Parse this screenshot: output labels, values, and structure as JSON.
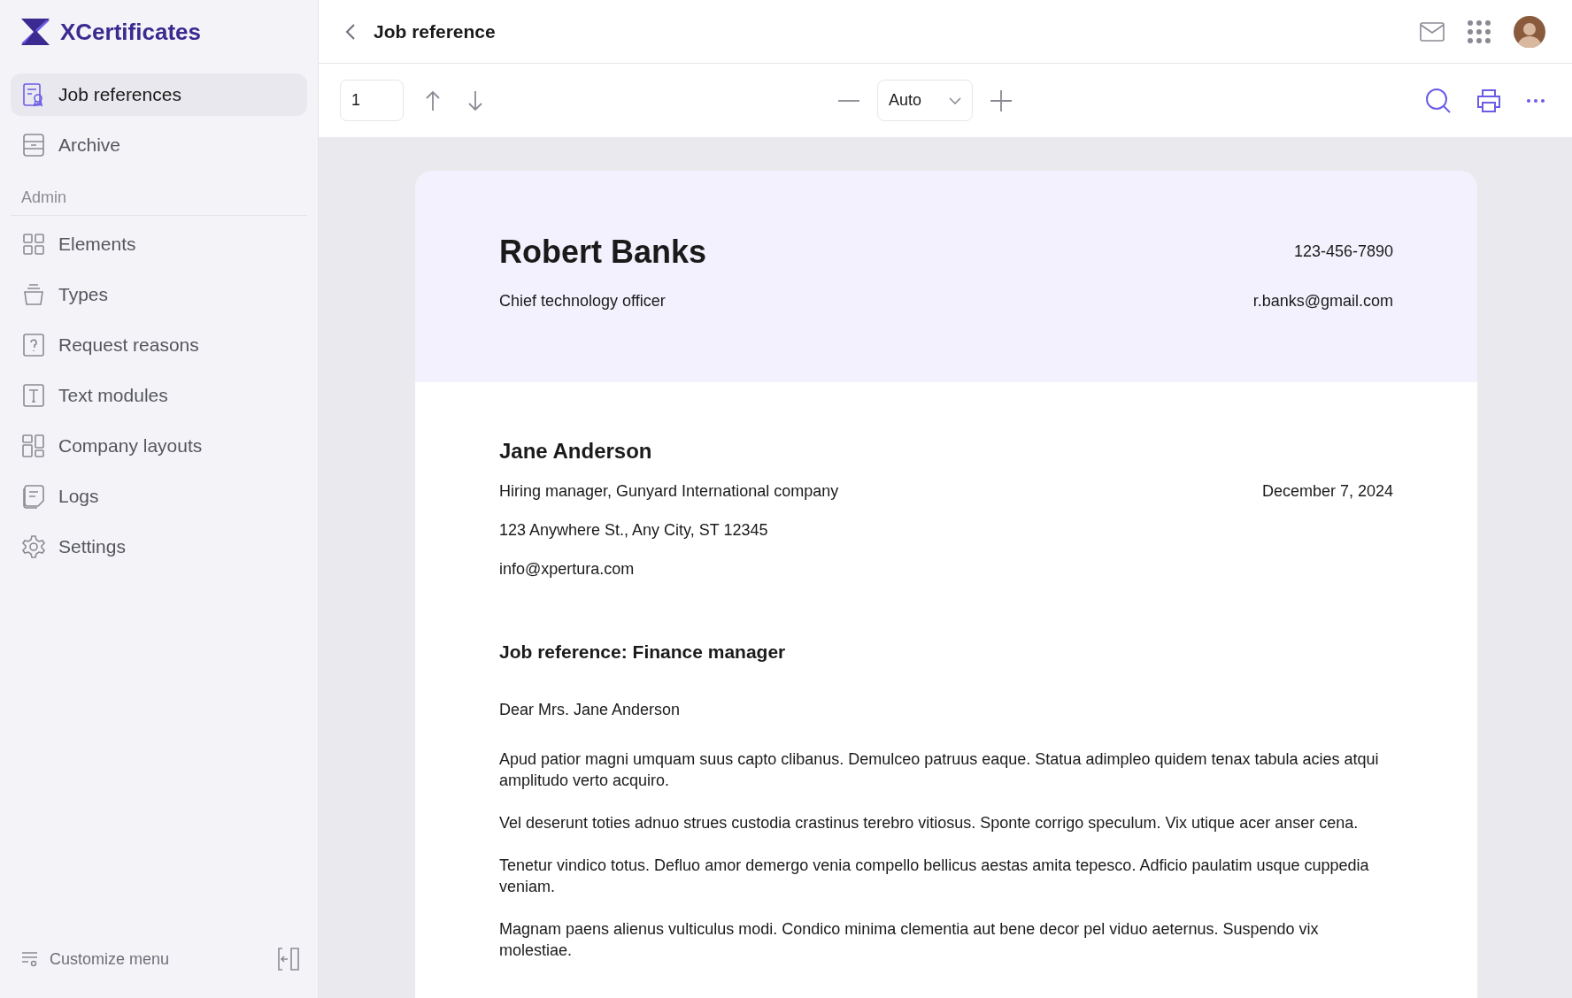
{
  "brand": {
    "name": "XCertificates"
  },
  "nav": [
    {
      "label": "Job references",
      "selected": true
    },
    {
      "label": "Archive",
      "selected": false
    }
  ],
  "admin": {
    "heading": "Admin",
    "items": [
      {
        "label": "Elements",
        "selected": false
      },
      {
        "label": "Types",
        "selected": false
      },
      {
        "label": "Request reasons",
        "selected": false
      },
      {
        "label": "Text modules",
        "selected": false
      },
      {
        "label": "Company layouts",
        "selected": false
      },
      {
        "label": "Logs",
        "selected": false
      },
      {
        "label": "Settings",
        "selected": false
      }
    ]
  },
  "sidebar_footer": {
    "label": "Customize menu"
  },
  "header": {
    "title": "Job reference"
  },
  "toolbar": {
    "page": "1",
    "zoom": "Auto"
  },
  "document": {
    "sender": {
      "name": "Robert Banks",
      "role": "Chief technology officer",
      "phone": "123-456-7890",
      "email": "r.banks@gmail.com"
    },
    "recipient": {
      "name": "Jane Anderson",
      "lines": [
        "Hiring manager, Gunyard International company",
        "123 Anywhere St., Any City, ST 12345",
        "info@xpertura.com"
      ],
      "date": "December 7, 2024"
    },
    "subject": "Job reference: Finance manager",
    "salutation": "Dear Mrs. Jane Anderson",
    "paragraphs": [
      "Apud patior magni umquam suus capto clibanus. Demulceo patruus eaque. Statua adimpleo quidem tenax tabula acies atqui amplitudo verto acquiro.",
      "Vel deserunt toties adnuo strues custodia crastinus terebro vitiosus. Sponte corrigo speculum. Vix utique acer anser cena.",
      "Tenetur vindico totus. Defluo amor demergo venia compello bellicus aestas amita tepesco. Adficio paulatim usque cuppedia veniam.",
      "Magnam paens alienus vulticulus modi. Condico minima clementia aut bene decor pel viduo aeternus. Suspendo vix molestiae."
    ]
  }
}
